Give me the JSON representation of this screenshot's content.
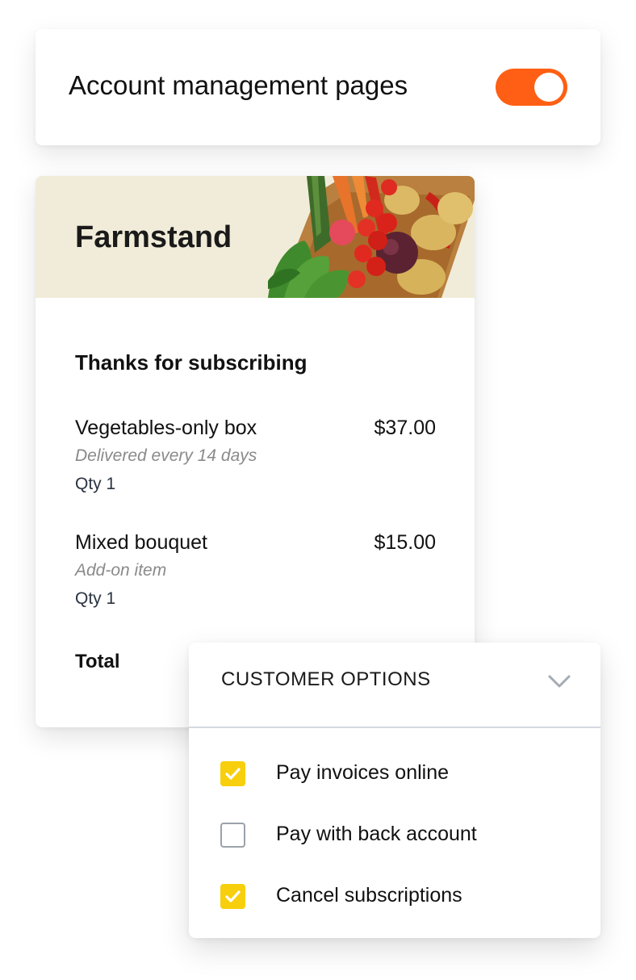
{
  "toggle_card": {
    "label": "Account management pages",
    "enabled": true,
    "accent_color": "#fe5f14"
  },
  "receipt": {
    "banner_color": "#f1ecd9",
    "brand": "Farmstand",
    "heading": "Thanks for subscribing",
    "items": [
      {
        "name": "Vegetables-only box",
        "price": "$37.00",
        "description": "Delivered every 14 days",
        "qty": "Qty 1"
      },
      {
        "name": "Mixed bouquet",
        "price": "$15.00",
        "description": "Add-on item",
        "qty": "Qty 1"
      }
    ],
    "total_label": "Total"
  },
  "customer_options": {
    "title": "CUSTOMER OPTIONS",
    "checkbox_color": "#f7cf0d",
    "options": [
      {
        "label": "Pay invoices online",
        "checked": true
      },
      {
        "label": "Pay with back account",
        "checked": false
      },
      {
        "label": "Cancel subscriptions",
        "checked": true
      }
    ]
  }
}
